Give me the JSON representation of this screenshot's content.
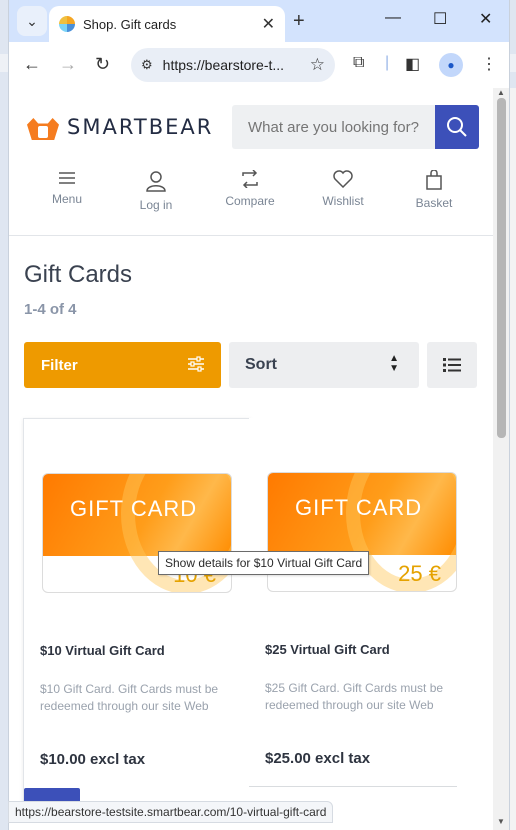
{
  "browser": {
    "tab_title": "Shop. Gift cards",
    "url": "https://bearstore-t...",
    "status_url": "https://bearstore-testsite.smartbear.com/10-virtual-gift-card"
  },
  "site": {
    "logo_text": "SMARTBEAR",
    "search_placeholder": "What are you looking for?",
    "nav": [
      {
        "label": "Menu"
      },
      {
        "label": "Log in"
      },
      {
        "label": "Compare"
      },
      {
        "label": "Wishlist"
      },
      {
        "label": "Basket"
      }
    ]
  },
  "page": {
    "heading": "Gift Cards",
    "count": "1-4 of 4",
    "filter_label": "Filter",
    "sort_label": "Sort"
  },
  "products": [
    {
      "card_label": "GIFT CARD",
      "value_label": "10 €",
      "title": "$10 Virtual Gift Card",
      "description": "$10 Gift Card. Gift Cards must be redeemed through our site Web",
      "price": "$10.00 excl tax"
    },
    {
      "card_label": "GIFT CARD",
      "value_label": "25 €",
      "title": "$25 Virtual Gift Card",
      "description": "$25 Gift Card. Gift Cards must be redeemed through our site Web",
      "price": "$25.00 excl tax"
    }
  ],
  "tooltip": "Show details for $10 Virtual Gift Card",
  "colors": {
    "brand_orange": "#ee9a00",
    "brand_blue": "#3c50b9",
    "logo_orange": "#f57c1f"
  }
}
